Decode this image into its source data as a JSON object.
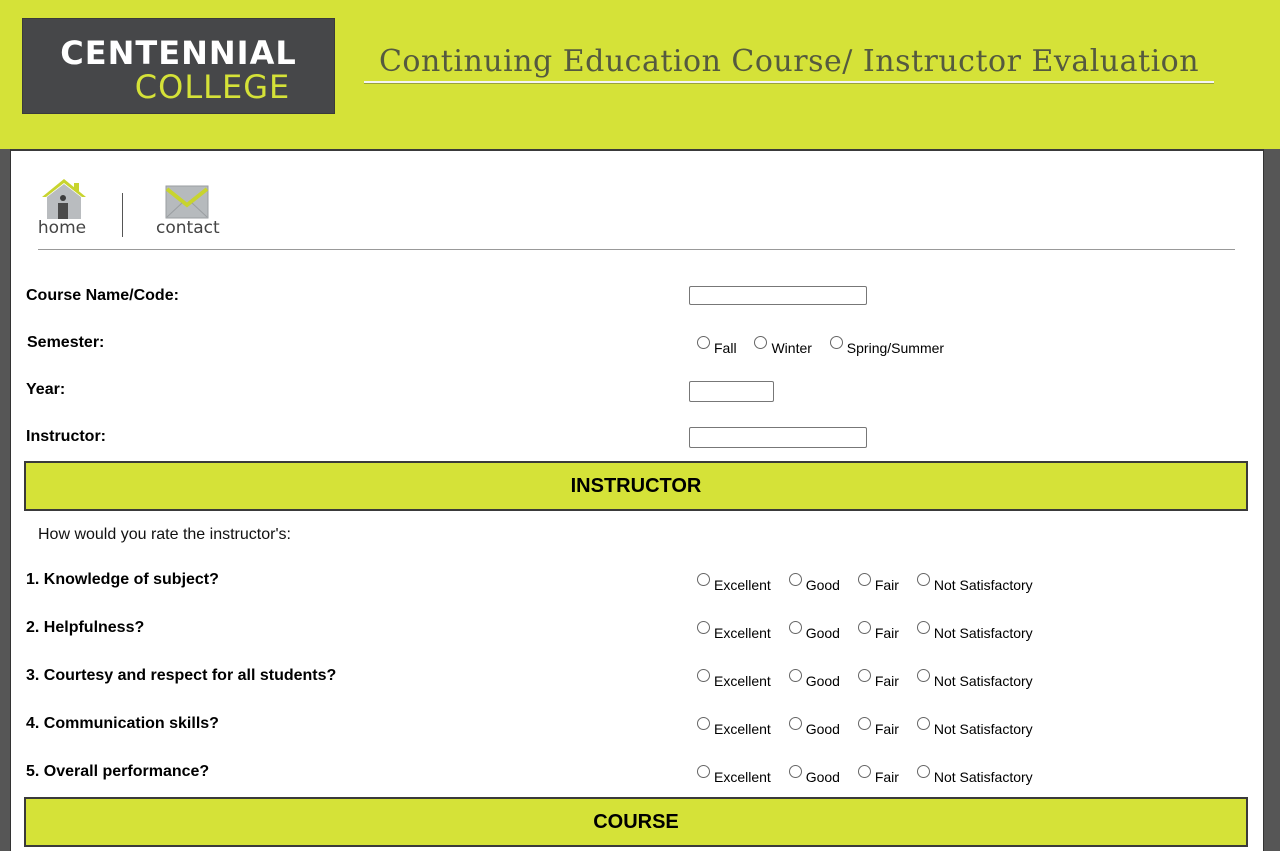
{
  "header": {
    "logo_line1": "CENTENNIAL",
    "logo_line2": "COLLEGE",
    "title": "Continuing Education Course/  Instructor Evaluation",
    "bg_color": "#d5e238",
    "logo_bg_color": "#464749"
  },
  "nav": {
    "home_label": "home",
    "contact_label": "contact",
    "home_icon": "home-icon",
    "contact_icon": "envelope-icon"
  },
  "form": {
    "course_label": "Course Name/Code:",
    "course_value": "",
    "semester_label": "Semester:",
    "semester_options": [
      "Fall",
      "Winter",
      "Spring/Summer"
    ],
    "year_label": "Year:",
    "year_value": "",
    "instructor_label": "Instructor:",
    "instructor_value": ""
  },
  "instructor_section": {
    "heading": "INSTRUCTOR",
    "intro": "How would you rate the instructor's:",
    "rating_options": [
      "Excellent",
      "Good",
      "Fair",
      "Not Satisfactory"
    ],
    "questions": [
      "1. Knowledge of subject?",
      "2. Helpfulness?",
      "3. Courtesy and respect for all students?",
      "4. Communication skills?",
      "5. Overall performance?"
    ]
  },
  "course_section": {
    "heading": "COURSE"
  }
}
